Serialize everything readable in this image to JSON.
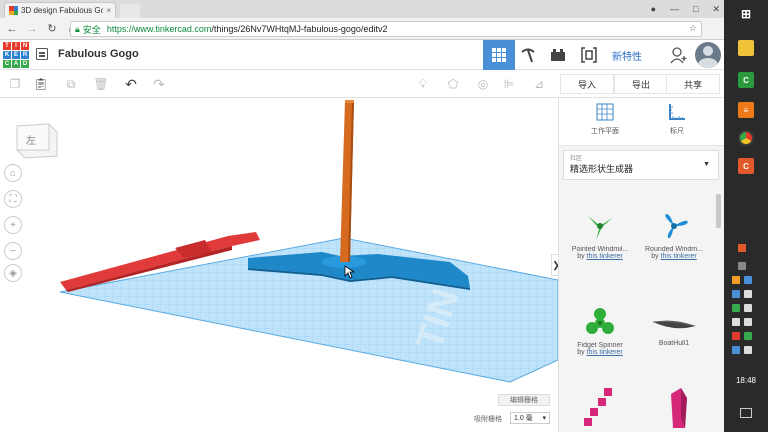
{
  "browser": {
    "tab_title": "3D design Fabulous Go",
    "tab_close": "×",
    "secure_label": "安全",
    "url_prefix": "https://www.tinkercad.com",
    "url_path": "/things/26Nv7WHtqMJ-fabulous-gogo/editv2",
    "back_icon": "arrow-left-icon",
    "forward_icon": "arrow-right-icon",
    "reload_icon": "reload-icon",
    "home_icon": "home-icon"
  },
  "logo": {
    "letters": [
      "TIN",
      "KER",
      "CAD"
    ]
  },
  "header": {
    "title": "Fabulous Gogo",
    "new_features": "新特性",
    "active_tab": "grid-view"
  },
  "toolbar": {
    "import": "导入",
    "export": "导出",
    "share": "共享"
  },
  "viewcube": {
    "face": "左"
  },
  "workspace": {
    "edit_grid": "编辑栅格",
    "snap_label": "吸附栅格",
    "snap_value": "1.0 毫"
  },
  "sidebar": {
    "workplane": "工作平面",
    "ruler": "标尺",
    "category_key": "社区",
    "category_value": "精选形状生成器",
    "shapes": [
      {
        "name": "Pointed Windmil...",
        "by_prefix": "by",
        "author": "this tinkerer",
        "color": "#2fae3a"
      },
      {
        "name": "Rounded Windm...",
        "by_prefix": "by",
        "author": "this tinkerer",
        "color": "#1e8fd6"
      },
      {
        "name": "Fidget Spinner",
        "by_prefix": "by",
        "author": "this tinkerer",
        "color": "#2fae3a"
      },
      {
        "name": "BoatHull1",
        "by_prefix": "",
        "author": "",
        "color": "#444444"
      }
    ]
  },
  "taskbar": {
    "time": "18:48"
  },
  "colors": {
    "accent": "#4a90d9",
    "grid": "#66b6ee",
    "red_part": "#e03a3a",
    "pole": "#d66a1e",
    "base": "#1e88c9"
  }
}
